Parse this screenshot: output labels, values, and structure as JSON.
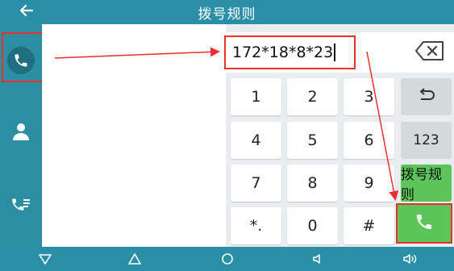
{
  "header": {
    "title": "拨号规则",
    "back_icon": "arrow-left-icon"
  },
  "sidebar": {
    "items": [
      {
        "name": "dialer",
        "icon": "phone-icon",
        "active": true
      },
      {
        "name": "contacts",
        "icon": "person-icon",
        "active": false
      },
      {
        "name": "call-log",
        "icon": "call-history-icon",
        "active": false
      }
    ]
  },
  "input": {
    "value": "172*18*8*23"
  },
  "keypad": {
    "keys": [
      "1",
      "2",
      "3",
      "4",
      "5",
      "6",
      "7",
      "8",
      "9",
      "*.",
      "0",
      "#"
    ],
    "mode_label": "123",
    "dial_rule_label": "拨号规则"
  },
  "colors": {
    "bar": "#2a8fa6",
    "sidebar": "#2b8ea3",
    "green": "#5cc55a",
    "annotation": "#e8302e"
  },
  "navbar": {
    "icons": [
      "back-triangle-icon",
      "home-icon",
      "recent-circle-icon",
      "volume-down-icon",
      "volume-up-icon"
    ]
  }
}
